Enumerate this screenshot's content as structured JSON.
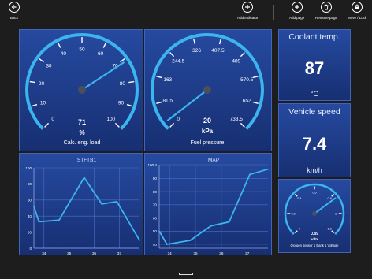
{
  "appbar": {
    "back_label": "Back",
    "add_indicator_label": "Add Indicator",
    "add_page_label": "Add page",
    "remove_page_label": "Remove page",
    "move_lock_label": "Move / Lock"
  },
  "gauges": [
    {
      "title": "Calc. eng. load",
      "unit": "%",
      "value": 71,
      "value_text": "71",
      "min": 0,
      "max": 100,
      "ticks": [
        "0",
        "10",
        "20",
        "30",
        "40",
        "50",
        "60",
        "70",
        "80",
        "90",
        "100"
      ]
    },
    {
      "title": "Fuel pressure",
      "unit": "kPa",
      "value": 20,
      "value_text": "20",
      "min": 0,
      "max": 733.5,
      "ticks": [
        "0",
        "81.5",
        "163",
        "244.5",
        "326",
        "407.5",
        "489",
        "570.5",
        "652",
        "733.5"
      ]
    }
  ],
  "tiles": [
    {
      "title": "Coolant temp.",
      "value": "87",
      "unit": "°C"
    },
    {
      "title": "Vehicle speed",
      "value": "7.4",
      "unit": "km/h"
    }
  ],
  "small_gauge": {
    "title": "Oxygen sensor 1 Bank 1 Voltage",
    "unit": "volts",
    "value": 0.89,
    "value_text": "0.89",
    "min": 0,
    "max": 1.275,
    "ticks": [
      "0",
      "0.2",
      "0.4",
      "0.6",
      "0.8",
      "1",
      "1.2"
    ]
  },
  "chart_data": [
    {
      "type": "line",
      "title": "STFTB1",
      "x": [
        33.6,
        33.8,
        34.6,
        35.6,
        36.3,
        36.9,
        37.8
      ],
      "y": [
        52,
        33,
        35,
        88,
        55,
        58,
        10
      ],
      "xticks": [
        "34",
        "35",
        "36",
        "37",
        "38"
      ],
      "yticks": [
        "0",
        "20",
        "40",
        "60",
        "80",
        "100"
      ],
      "xlim": [
        33.6,
        37.8
      ],
      "ylim": [
        0,
        100
      ],
      "grid": true
    },
    {
      "type": "line",
      "title": "MAP",
      "x": [
        33.6,
        33.9,
        34.8,
        35.6,
        36.3,
        37.1,
        37.8
      ],
      "y": [
        50,
        40,
        43,
        54,
        57,
        93,
        97
      ],
      "xticks": [
        "34",
        "35",
        "36",
        "37",
        "38"
      ],
      "yticks": [
        "40",
        "50",
        "60",
        "70",
        "80",
        "90",
        "100.4"
      ],
      "xlim": [
        33.6,
        37.8
      ],
      "ylim": [
        37,
        100.4
      ],
      "grid": true
    }
  ],
  "colors": {
    "accent": "#3cb4ee",
    "panel": "#1f3f8e",
    "border": "#3f64b8"
  }
}
